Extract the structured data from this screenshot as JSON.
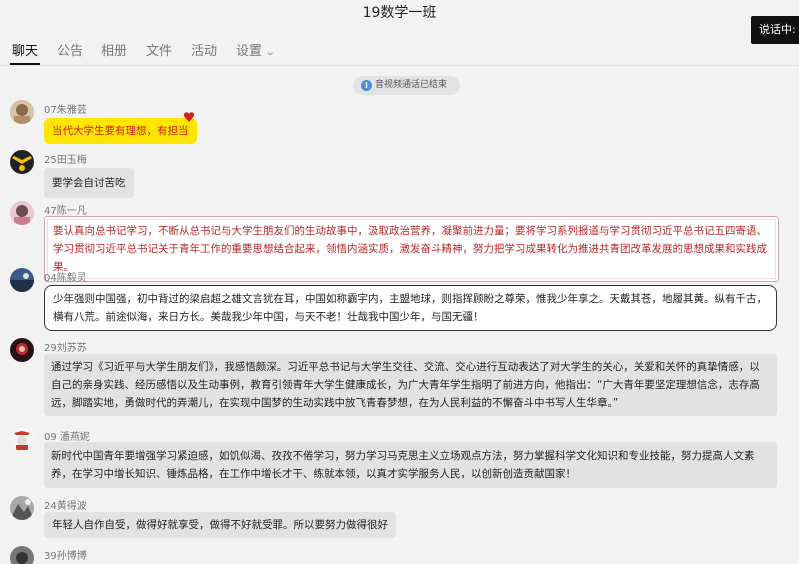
{
  "window": {
    "title": "19数学一班"
  },
  "speaking_badge": "说话中:",
  "tabs": [
    {
      "label": "聊天",
      "active": true
    },
    {
      "label": "公告",
      "active": false
    },
    {
      "label": "相册",
      "active": false
    },
    {
      "label": "文件",
      "active": false
    },
    {
      "label": "活动",
      "active": false
    },
    {
      "label": "设置",
      "active": false
    }
  ],
  "system_notice": "音视频通话已结束",
  "messages": [
    {
      "name": "07朱雅芸",
      "text": "当代大学生要有理想，有担当"
    },
    {
      "name": "25田玉梅",
      "text": "要学会自讨苦吃"
    },
    {
      "name": "47陈一凡",
      "text": "要认真向总书记学习，不断从总书记与大学生朋友们的生动故事中，汲取政治营养，凝聚前进力量；要将学习系列报道与学习贯彻习近平总书记五四寄语、学习贯彻习近平总书记关于青年工作的重要思想结合起来，领悟内涵实质，激发奋斗精神，努力把学习成果转化为推进共青团改革发展的思想成果和实践成果。"
    },
    {
      "name": "04陈毅灵",
      "text": "少年强则中国强，初中背过的梁启超之雄文言犹在耳，中国如称霸宇内，主盟地球，则指挥顾盼之尊荣，惟我少年享之。天戴其苍，地履其黄。纵有千古，横有八荒。前途似海，来日方长。美哉我少年中国，与天不老！壮哉我中国少年，与国无疆！"
    },
    {
      "name": "29刘苏苏",
      "text": "通过学习《习近平与大学生朋友们》，我感悟颇深。习近平总书记与大学生交往、交流、交心进行互动表达了对大学生的关心，关爱和关怀的真挚情感，以自己的亲身实践、经历感悟以及生动事例，教育引领青年大学生健康成长，为广大青年学生指明了前进方向，他指出：“广大青年要坚定理想信念，志存高远，脚踏实地，勇做时代的弄潮儿，在实现中国梦的生动实践中放飞青春梦想，在为人民利益的不懈奋斗中书写人生华章。”"
    },
    {
      "name": "09 潘燕妮",
      "text": "新时代中国青年要增强学习紧迫感，如饥似渴、孜孜不倦学习，努力学习马克思主义立场观点方法，努力掌握科学文化知识和专业技能，努力提高人文素养，在学习中增长知识、锤炼品格，在工作中增长才干、练就本领，以真才实学服务人民，以创新创造贡献国家！"
    },
    {
      "name": "24黄得波",
      "text": "年轻人自作自受，做得好就享受，做得不好就受罪。所以要努力做得很好"
    },
    {
      "name": "39孙博博",
      "text": ""
    }
  ],
  "colors": {
    "accent": "#111111",
    "yellow_bubble": "#ffe600",
    "scroll_text": "#b7282b",
    "gray_bubble": "#e2e2e2"
  }
}
